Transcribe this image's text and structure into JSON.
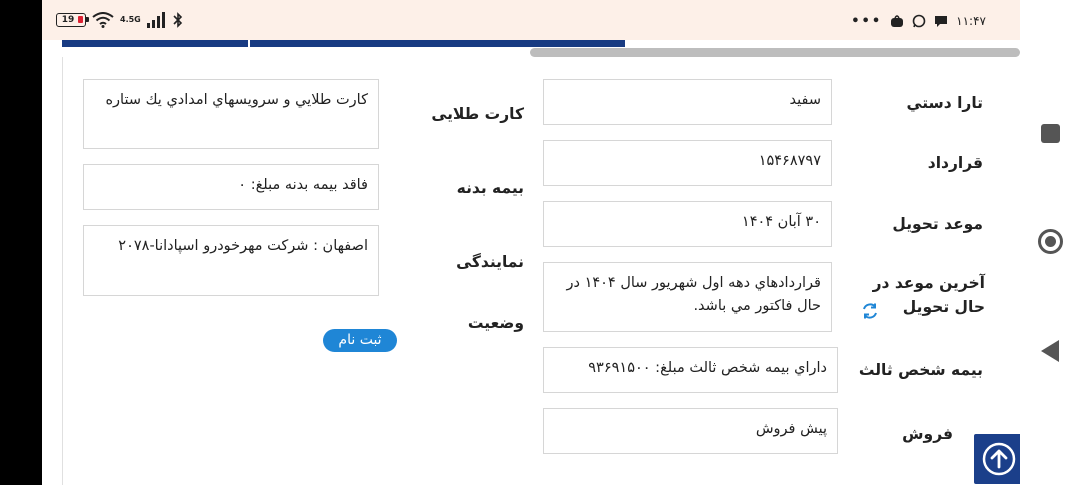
{
  "status_bar": {
    "battery": "19",
    "network": "4.5G",
    "time": "١١:۴٧",
    "overflow": "•••",
    "icons": [
      "battery-icon",
      "wifi-icon",
      "signal-icon",
      "bluetooth-icon",
      "bag-icon",
      "whatsapp-icon",
      "chat-icon"
    ]
  },
  "left_column": {
    "golden_card": {
      "label": "کارت طلایی",
      "value": "كارت طلايي و سرويسهاي امدادي يك ستاره"
    },
    "body_insurance": {
      "label": "بیمه بدنه",
      "value": "فاقد بيمه بدنه مبلغ: ٠"
    },
    "agency": {
      "label": "نمایندگی",
      "value": "اصفهان : شركت مهرخودرو اسپادانا-۲۰۷۸"
    },
    "status": {
      "label": "وضعیت",
      "badge": "ثبت نام"
    }
  },
  "right_column": {
    "tara": {
      "label": "تارا دستي",
      "value": "سفيد"
    },
    "contract": {
      "label": "قرارداد",
      "value": "١۵۴۶٨٧٩٧"
    },
    "delivery_date": {
      "label": "موعد تحویل",
      "value": "٣٠ آبان ١۴٠۴"
    },
    "latest_delivery": {
      "label": "آخرین موعد در حال تحویل",
      "value": "قراردادهاي دهه اول شهريور سال ١۴٠۴ در حال فاكتور مي باشد."
    },
    "third_party": {
      "label": "بیمه شخص ثالث",
      "value": "داراي بيمه شخص ثالث مبلغ: ٩٣۶٩١۵٠٠"
    },
    "sale": {
      "label": "فروش",
      "value": "پيش فروش"
    }
  },
  "colors": {
    "accent": "#183b82",
    "badge": "#1f86d6",
    "status_bar_bg": "#fdf0e8"
  }
}
